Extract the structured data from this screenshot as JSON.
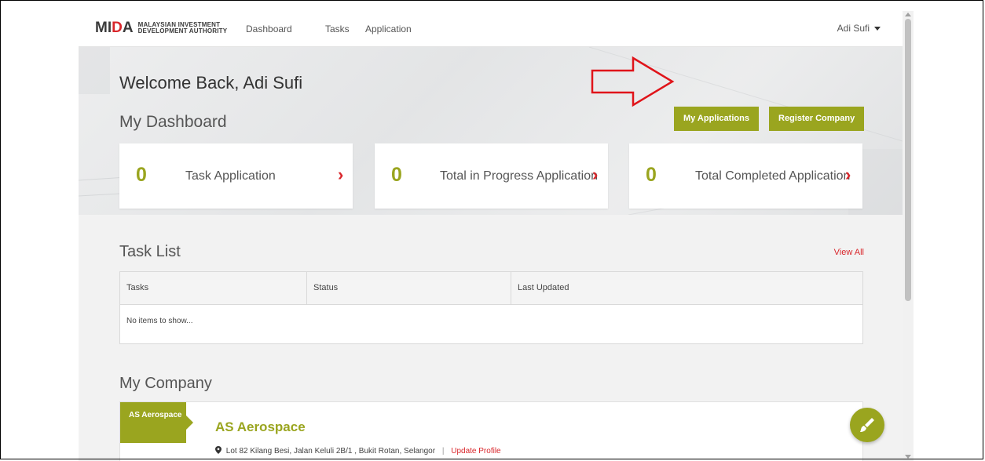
{
  "navbar": {
    "logo_mark": "MIDA",
    "logo_line1": "MALAYSIAN INVESTMENT",
    "logo_line2": "DEVELOPMENT AUTHORITY",
    "links": [
      "Dashboard",
      "Tasks",
      "Application"
    ],
    "user_name": "Adi Sufi"
  },
  "hero": {
    "welcome": "Welcome Back, Adi Sufi",
    "dashboard_title": "My Dashboard",
    "my_applications_label": "My Applications",
    "register_company_label": "Register Company"
  },
  "stats": [
    {
      "value": "0",
      "label": "Task Application"
    },
    {
      "value": "0",
      "label": "Total in Progress Application"
    },
    {
      "value": "0",
      "label": "Total Completed Application"
    }
  ],
  "task_list": {
    "title": "Task List",
    "view_all": "View All",
    "columns": [
      "Tasks",
      "Status",
      "Last Updated"
    ],
    "empty_text": "No items to show..."
  },
  "company": {
    "section_title": "My Company",
    "tab_label": "AS Aerospace",
    "name": "AS Aerospace",
    "address": "Lot 82 Kilang Besi, Jalan Keluli 2B/1 , Bukit Rotan, Selangor",
    "separator": "|",
    "update_profile": "Update Profile"
  },
  "icons": {
    "stat_chevron": "chevron-right-icon",
    "address": "map-pin-icon",
    "fab": "paint-brush-icon",
    "annotation": "red-arrow"
  },
  "colors": {
    "brand_green": "#9aa51f",
    "accent_red": "#d9262b"
  }
}
